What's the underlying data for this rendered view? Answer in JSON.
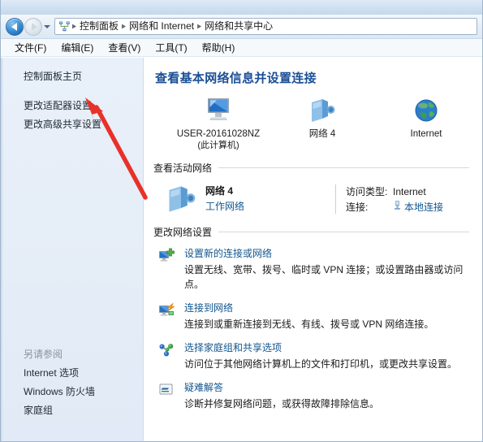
{
  "window": {
    "nav": {
      "back_tooltip": "后退",
      "forward_tooltip": "前进",
      "recent_tooltip": "最近浏览的位置",
      "address_icon": "network-icon",
      "breadcrumbs": [
        "控制面板",
        "网络和 Internet",
        "网络和共享中心"
      ],
      "separator": "▶"
    },
    "menu": [
      {
        "label": "文件(F)"
      },
      {
        "label": "编辑(E)"
      },
      {
        "label": "查看(V)"
      },
      {
        "label": "工具(T)"
      },
      {
        "label": "帮助(H)"
      }
    ]
  },
  "sidebar": {
    "home_label": "控制面板主页",
    "links": [
      {
        "label": "更改适配器设置"
      },
      {
        "label": "更改高级共享设置"
      }
    ],
    "see_also_header": "另请参阅",
    "see_also": [
      {
        "label": "Internet 选项"
      },
      {
        "label": "Windows 防火墙"
      },
      {
        "label": "家庭组"
      }
    ]
  },
  "main": {
    "page_title": "查看基本网络信息并设置连接",
    "network_map": {
      "computer": {
        "icon": "computer-icon",
        "name": "USER-20161028NZ",
        "sub": "(此计算机)"
      },
      "network": {
        "icon": "network-server-icon",
        "name": "网络  4"
      },
      "internet": {
        "icon": "globe-icon",
        "name": "Internet"
      }
    },
    "active_networks": {
      "section_title": "查看活动网络",
      "entry": {
        "icon": "network-server-icon",
        "name": "网络  4",
        "type": "工作网络",
        "access_key": "访问类型:",
        "access_value": "Internet",
        "connection_key": "连接:",
        "connection_icon": "lan-connection-icon",
        "connection_value": "本地连接"
      }
    },
    "change_settings": {
      "section_title": "更改网络设置",
      "items": [
        {
          "icon": "new-connection-icon",
          "title": "设置新的连接或网络",
          "desc": "设置无线、宽带、拨号、临时或 VPN 连接；或设置路由器或访问点。"
        },
        {
          "icon": "connect-to-network-icon",
          "title": "连接到网络",
          "desc": "连接到或重新连接到无线、有线、拨号或 VPN 网络连接。"
        },
        {
          "icon": "homegroup-icon",
          "title": "选择家庭组和共享选项",
          "desc": "访问位于其他网络计算机上的文件和打印机，或更改共享设置。"
        },
        {
          "icon": "troubleshoot-icon",
          "title": "疑难解答",
          "desc": "诊断并修复网络问题，或获得故障排除信息。"
        }
      ]
    }
  },
  "annotation": {
    "arrow": {
      "color": "#e8312a",
      "points_to": "更改适配器设置"
    }
  },
  "colors": {
    "accent_link": "#12558f",
    "page_title": "#1b4f96",
    "sidebar_bg": "#e5edf7",
    "annotation_red": "#e8312a"
  }
}
